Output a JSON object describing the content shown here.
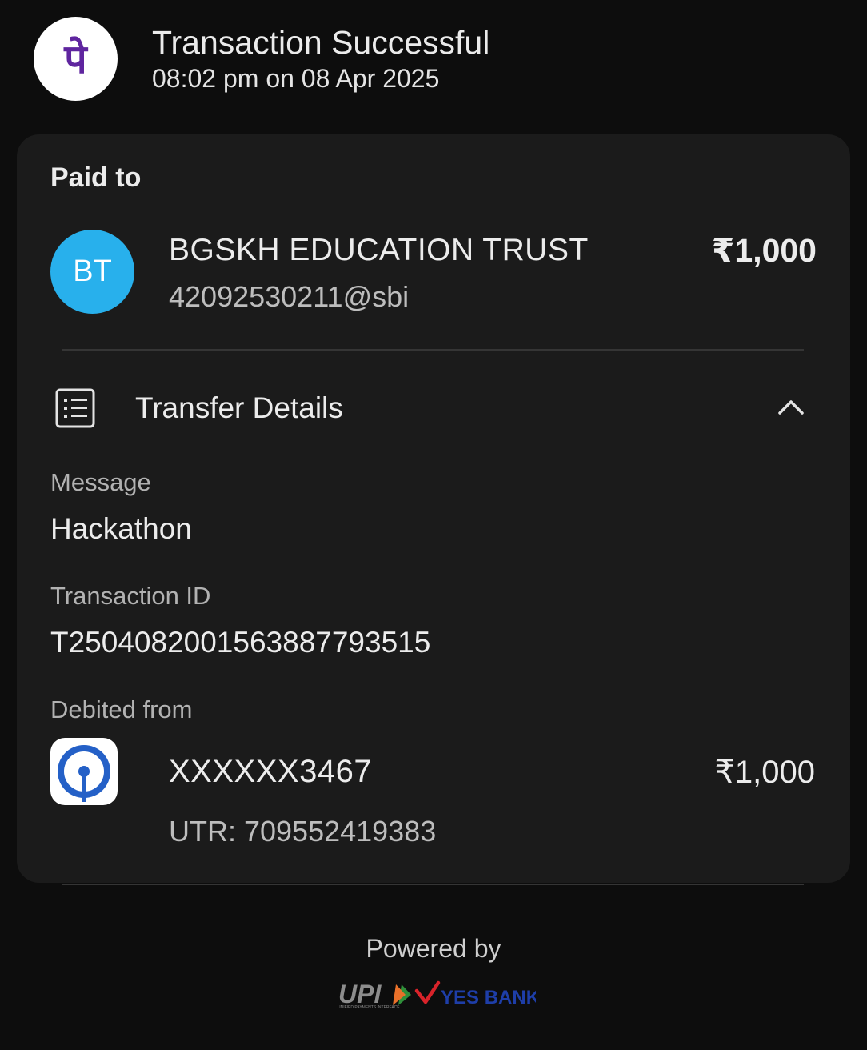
{
  "header": {
    "app_icon": "phonepe-logo-icon",
    "app_logo_glyph": "पे",
    "title": "Transaction Successful",
    "datetime": "08:02 pm on 08 Apr 2025"
  },
  "paid_to": {
    "label": "Paid to",
    "avatar_initials": "BT",
    "avatar_color": "#28b0ec",
    "name": "BGSKH EDUCATION TRUST",
    "upi_id": "42092530211@sbi",
    "amount": "₹1,000"
  },
  "transfer_details": {
    "icon": "receipt-list-icon",
    "title": "Transfer Details",
    "toggle_icon": "chevron-up-icon",
    "message": {
      "label": "Message",
      "value": "Hackathon"
    },
    "transaction_id": {
      "label": "Transaction ID",
      "value": "T2504082001563887793515"
    },
    "debited_from": {
      "label": "Debited from",
      "bank_icon": "sbi-logo-icon",
      "account": "XXXXXX3467",
      "amount": "₹1,000",
      "utr": "UTR: 709552419383"
    }
  },
  "footer": {
    "powered_by": "Powered by",
    "logos": {
      "upi_text": "UPI",
      "upi_tagline": "UNIFIED PAYMENTS INTERFACE",
      "bank_text": "YES BANK"
    }
  },
  "colors": {
    "background": "#0d0d0d",
    "card": "#1b1b1b",
    "brand_purple": "#5f259f",
    "avatar_blue": "#28b0ec",
    "sbi_blue": "#2460c7",
    "yes_bank_blue": "#1e3ea8",
    "yes_bank_red": "#d8232a"
  }
}
